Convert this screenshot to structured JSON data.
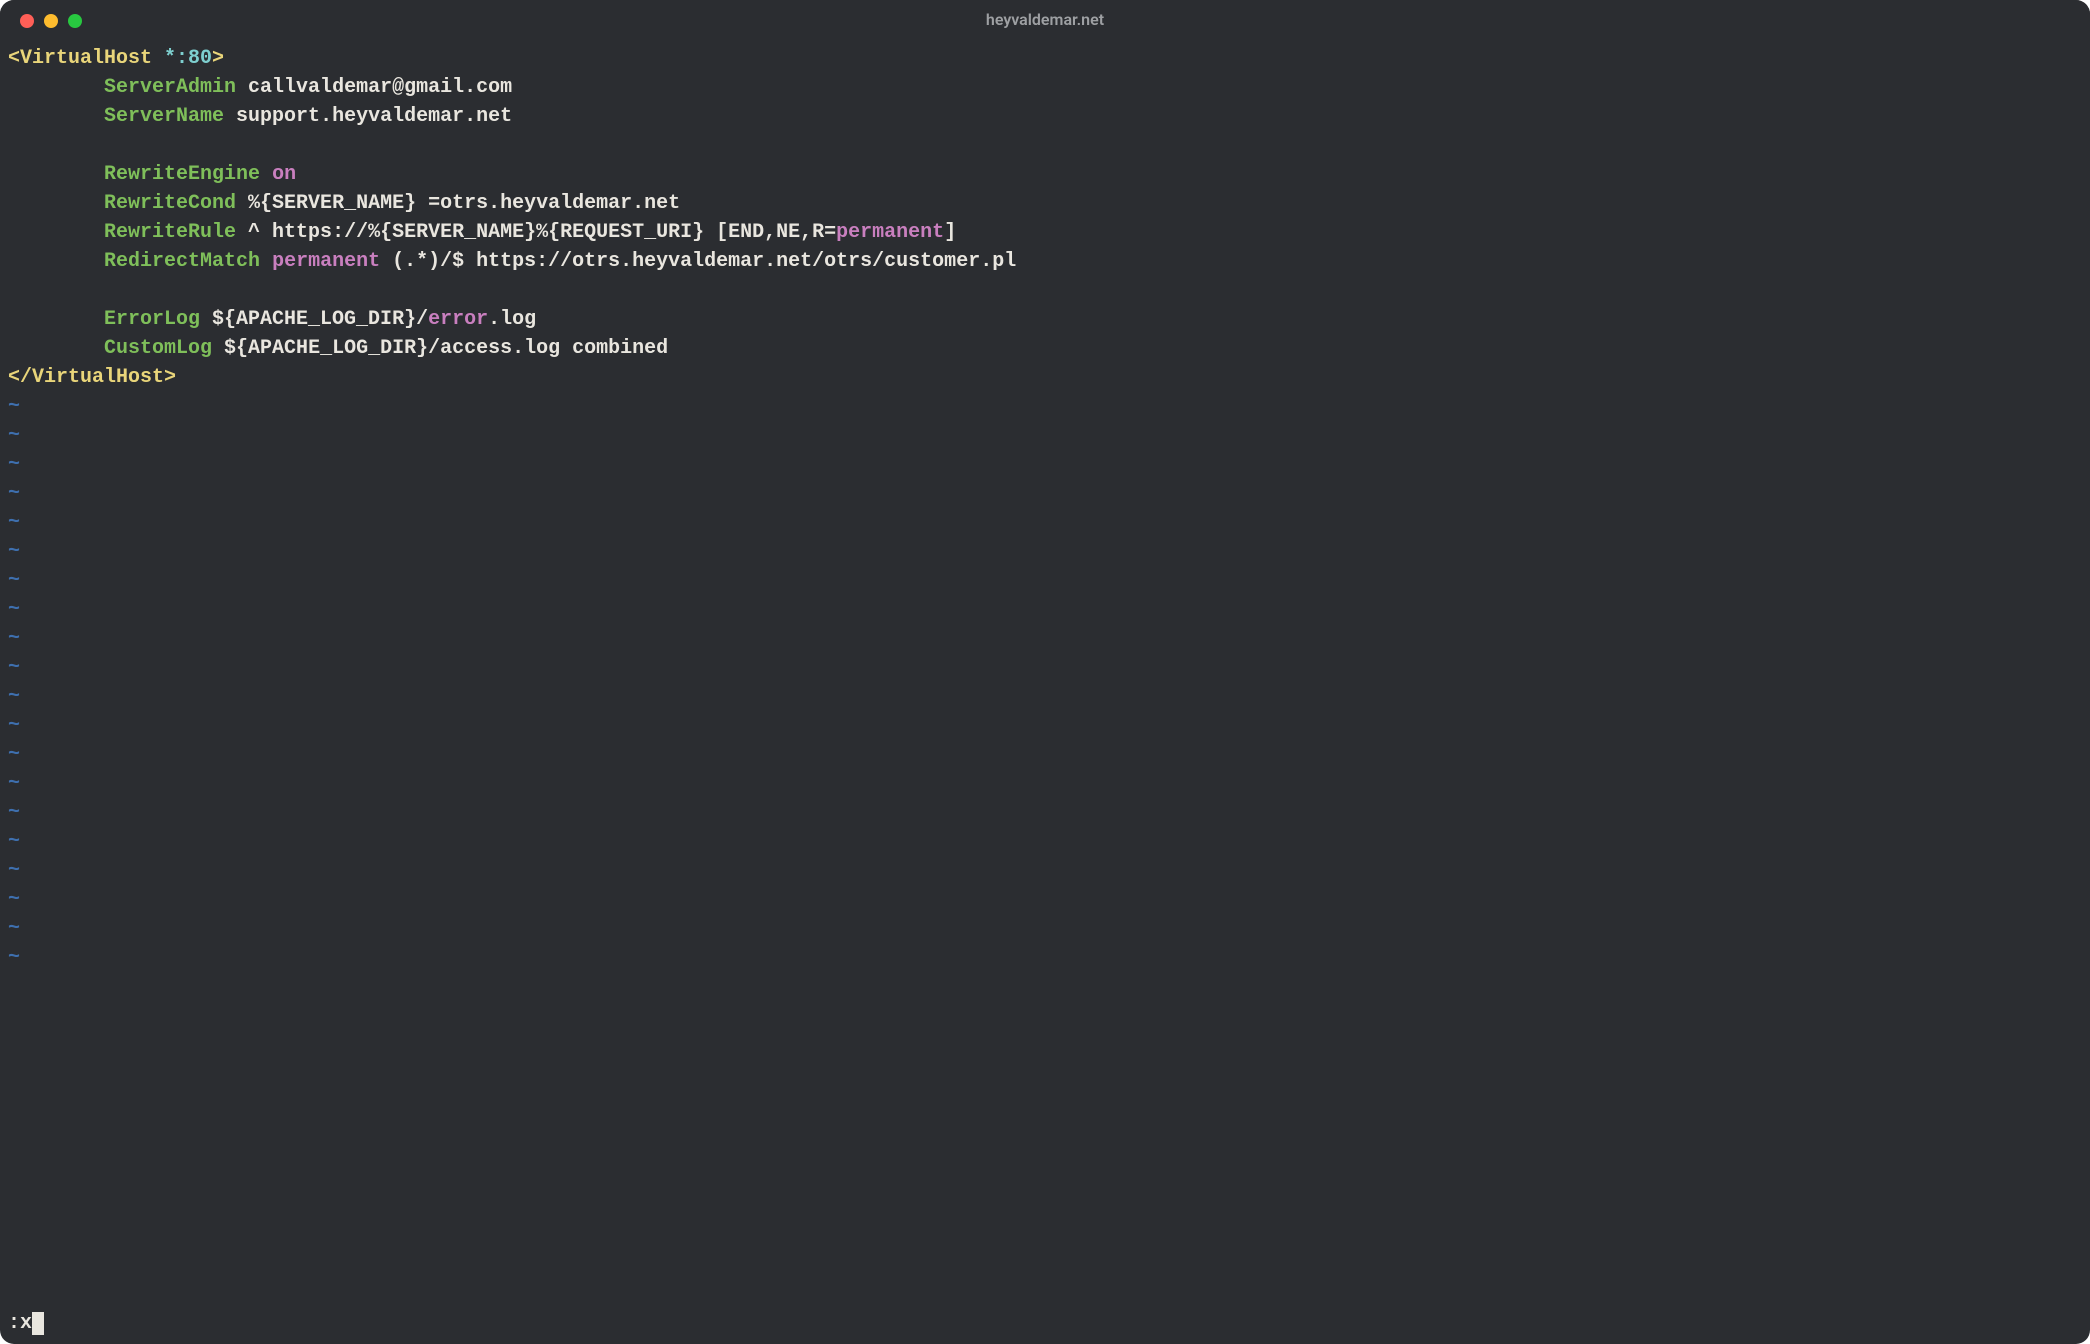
{
  "window": {
    "title": "heyvaldemar.net"
  },
  "content": {
    "open_tag_l": "<VirtualHost ",
    "open_tag_m": "*:80",
    "open_tag_r": ">",
    "indent": "        ",
    "l1_kw": "ServerAdmin",
    "l1_rest": " callvaldemar@gmail.com",
    "l2_kw": "ServerName",
    "l2_rest": " support.heyvaldemar.net",
    "l3_kw": "RewriteEngine",
    "l3_sp": " ",
    "l3_val": "on",
    "l4_kw": "RewriteCond",
    "l4_rest": " %{SERVER_NAME} =otrs.heyvaldemar.net",
    "l5_kw": "RewriteRule",
    "l5_mid": " ^ https://%{SERVER_NAME}%{REQUEST_URI} [END,NE,R=",
    "l5_val": "permanent",
    "l5_tail": "]",
    "l6_kw": "RedirectMatch",
    "l6_sp": " ",
    "l6_val": "permanent",
    "l6_rest": " (.*)/$ https://otrs.heyvaldemar.net/otrs/customer.pl",
    "l7_kw": "ErrorLog",
    "l7_mid": " ${APACHE_LOG_DIR}/",
    "l7_val": "error",
    "l7_tail": ".log",
    "l8_kw": "CustomLog",
    "l8_rest": " ${APACHE_LOG_DIR}/access.log combined",
    "close_tag": "</VirtualHost>",
    "tilde": "~"
  },
  "status": {
    "command": ":x"
  },
  "tilde_count": 20
}
